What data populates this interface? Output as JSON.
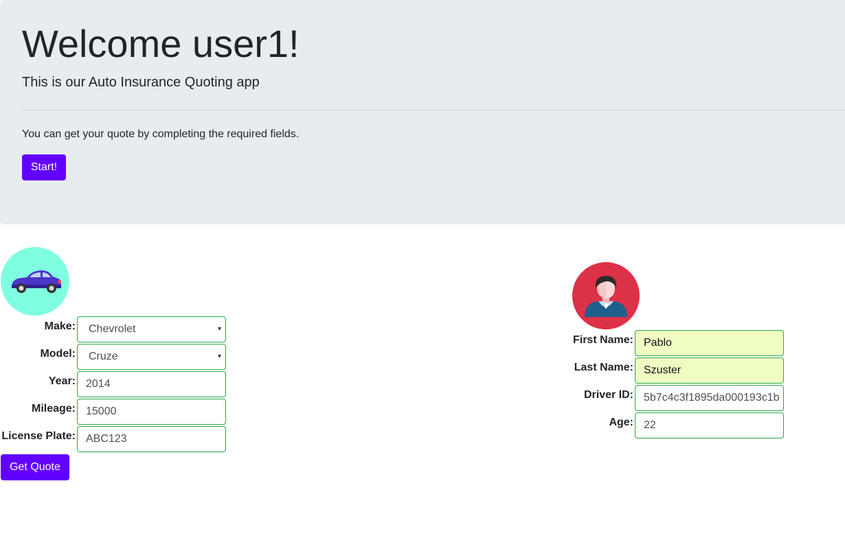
{
  "header": {
    "title": "Welcome user1!",
    "lead": "This is our Auto Insurance Quoting app",
    "text": "You can get your quote by completing the required fields.",
    "start_label": "Start!"
  },
  "vehicle": {
    "icon": "car-icon",
    "make_label": "Make:",
    "make_value": "Chevrolet",
    "model_label": "Model:",
    "model_value": "Cruze",
    "year_label": "Year:",
    "year_value": "2014",
    "mileage_label": "Mileage:",
    "mileage_value": "15000",
    "plate_label": "License Plate:",
    "plate_value": "ABC123",
    "quote_label": "Get Quote"
  },
  "driver": {
    "icon": "person-avatar-icon",
    "first_label": "First Name:",
    "first_value": "Pablo",
    "last_label": "Last Name:",
    "last_value": "Szuster",
    "id_label": "Driver ID:",
    "id_value": "5b7c4c3f1895da000193c1b",
    "age_label": "Age:",
    "age_value": "22"
  },
  "colors": {
    "primary": "#6200ff",
    "jumbotron_bg": "#e9ecef",
    "valid_border": "#28a745",
    "autofill_bg": "#effdc3",
    "car_avatar_bg": "#7fffe0",
    "person_avatar_bg": "#dd3147"
  }
}
